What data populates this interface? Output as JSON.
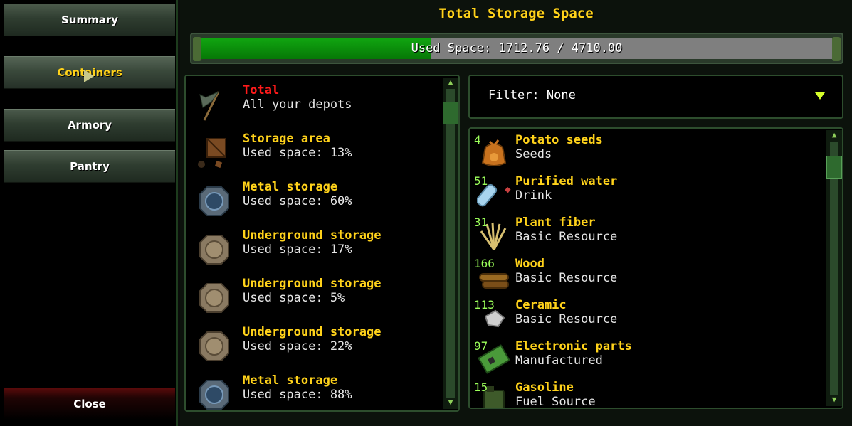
{
  "sidebar": {
    "items": [
      {
        "label": "Summary"
      },
      {
        "label": "Containers"
      },
      {
        "label": "Armory"
      },
      {
        "label": "Pantry"
      }
    ],
    "close_label": "Close"
  },
  "header": {
    "title": "Total Storage Space"
  },
  "storage_bar": {
    "text": "Used Space: 1712.76 / 4710.00",
    "used": 1712.76,
    "total": 4710.0
  },
  "depots": [
    {
      "name": "Total",
      "sub": "All your depots",
      "icon": "flag-icon"
    },
    {
      "name": "Storage area",
      "sub": "Used space: 13%",
      "icon": "crate-icon"
    },
    {
      "name": "Metal storage",
      "sub": "Used space: 60%",
      "icon": "metal-hatch-icon"
    },
    {
      "name": "Underground storage",
      "sub": "Used space: 17%",
      "icon": "underground-hatch-icon"
    },
    {
      "name": "Underground storage",
      "sub": "Used space: 5%",
      "icon": "underground-hatch-icon"
    },
    {
      "name": "Underground storage",
      "sub": "Used space: 22%",
      "icon": "underground-hatch-icon"
    },
    {
      "name": "Metal storage",
      "sub": "Used space: 88%",
      "icon": "metal-hatch-icon"
    }
  ],
  "filter": {
    "label": "Filter: None"
  },
  "items": [
    {
      "qty": "4",
      "name": "Potato seeds",
      "category": "Seeds",
      "icon": "seed-bag-icon"
    },
    {
      "qty": "51",
      "name": "Purified water",
      "category": "Drink",
      "icon": "water-bottle-icon"
    },
    {
      "qty": "31",
      "name": "Plant fiber",
      "category": "Basic Resource",
      "icon": "plant-fiber-icon"
    },
    {
      "qty": "166",
      "name": "Wood",
      "category": "Basic Resource",
      "icon": "wood-logs-icon"
    },
    {
      "qty": "113",
      "name": "Ceramic",
      "category": "Basic Resource",
      "icon": "ceramic-icon"
    },
    {
      "qty": "97",
      "name": "Electronic parts",
      "category": "Manufactured",
      "icon": "circuit-board-icon"
    },
    {
      "qty": "15",
      "name": "Gasoline",
      "category": "Fuel Source",
      "icon": "jerrycan-icon"
    }
  ],
  "colors": {
    "accent": "#ffd21a",
    "bar_fill": "#0c9a0c",
    "quantity": "#9cff5a",
    "total_label": "#ff1a1a"
  }
}
